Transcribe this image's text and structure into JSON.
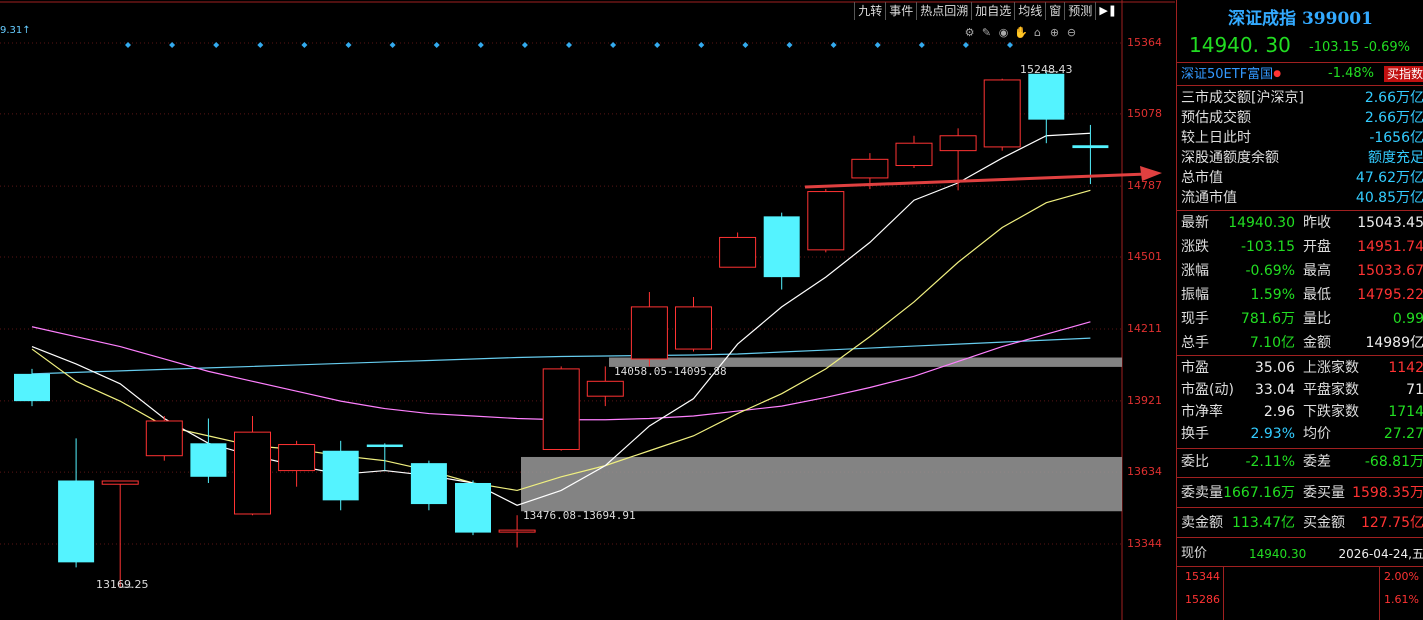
{
  "toolbar": {
    "items": [
      "九转",
      "事件",
      "热点回溯",
      "加自选",
      "均线",
      "窗",
      "预测"
    ],
    "playback_icon": "play-pause-icon"
  },
  "mini_icons": [
    "settings-icon",
    "pen-icon",
    "eye-icon",
    "hand-icon",
    "lock-icon",
    "zoom-in-icon",
    "zoom-out-icon"
  ],
  "top_left_label": "9.31↑",
  "colors": {
    "up": "#ff3333",
    "down": "#54f3ff",
    "ma5": "#ffffff",
    "ma10": "#f0f080",
    "ma20": "#ff80ff",
    "ma60": "#66ccee",
    "arrow": "#e04040",
    "zone": "#9a9a9a",
    "diamond": "#33aaee"
  },
  "chart_data": {
    "type": "candlestick",
    "y_ticks": [
      "15364",
      "15078",
      "14787",
      "14501",
      "14211",
      "13921",
      "13634",
      "13344"
    ],
    "ylim": [
      13170,
      15400
    ],
    "candles": [
      {
        "o": 14030,
        "c": 13920,
        "h": 14050,
        "l": 13900
      },
      {
        "o": 13600,
        "c": 13270,
        "h": 13770,
        "l": 13250
      },
      {
        "o": 13585,
        "c": 13598,
        "h": 13600,
        "l": 13170
      },
      {
        "o": 13700,
        "c": 13840,
        "h": 13860,
        "l": 13680
      },
      {
        "o": 13750,
        "c": 13615,
        "h": 13850,
        "l": 13590
      },
      {
        "o": 13465,
        "c": 13795,
        "h": 13860,
        "l": 13460
      },
      {
        "o": 13640,
        "c": 13745,
        "h": 13760,
        "l": 13575
      },
      {
        "o": 13720,
        "c": 13520,
        "h": 13760,
        "l": 13480
      },
      {
        "o": 13745,
        "c": 13735,
        "h": 13750,
        "l": 13640
      },
      {
        "o": 13670,
        "c": 13505,
        "h": 13680,
        "l": 13480
      },
      {
        "o": 13590,
        "c": 13390,
        "h": 13600,
        "l": 13380
      },
      {
        "o": 13400,
        "c": 13400,
        "h": 13460,
        "l": 13330
      },
      {
        "o": 13725,
        "c": 14050,
        "h": 14060,
        "l": 13720
      },
      {
        "o": 13940,
        "c": 14000,
        "h": 14060,
        "l": 13900
      },
      {
        "o": 14090,
        "c": 14300,
        "h": 14360,
        "l": 14060
      },
      {
        "o": 14130,
        "c": 14300,
        "h": 14340,
        "l": 14120
      },
      {
        "o": 14460,
        "c": 14580,
        "h": 14600,
        "l": 14460
      },
      {
        "o": 14665,
        "c": 14420,
        "h": 14680,
        "l": 14370
      },
      {
        "o": 14530,
        "c": 14765,
        "h": 14775,
        "l": 14520
      },
      {
        "o": 14820,
        "c": 14895,
        "h": 14920,
        "l": 14775
      },
      {
        "o": 14870,
        "c": 14960,
        "h": 14990,
        "l": 14860
      },
      {
        "o": 14930,
        "c": 14990,
        "h": 15020,
        "l": 14770
      },
      {
        "o": 14945,
        "c": 15215,
        "h": 15220,
        "l": 14930
      },
      {
        "o": 15240,
        "c": 15055,
        "h": 15248.43,
        "l": 14960
      },
      {
        "o": 14951.74,
        "c": 14940.3,
        "h": 15033.67,
        "l": 14795.22
      }
    ],
    "ma5": [
      14140,
      14070,
      13990,
      13850,
      13750,
      13700,
      13660,
      13625,
      13640,
      13620,
      13590,
      13500,
      13560,
      13660,
      13820,
      13930,
      14150,
      14300,
      14420,
      14560,
      14730,
      14800,
      14900,
      14990,
      15000
    ],
    "ma10": [
      14130,
      14000,
      13920,
      13820,
      13780,
      13740,
      13725,
      13700,
      13680,
      13640,
      13590,
      13560,
      13615,
      13660,
      13720,
      13780,
      13870,
      13950,
      14050,
      14180,
      14320,
      14480,
      14620,
      14720,
      14770
    ],
    "ma20": [
      14220,
      14180,
      14140,
      14090,
      14040,
      14000,
      13960,
      13920,
      13890,
      13870,
      13860,
      13850,
      13845,
      13845,
      13850,
      13860,
      13880,
      13900,
      13935,
      13975,
      14020,
      14080,
      14140,
      14190,
      14240
    ],
    "ma60": [
      14030,
      14036,
      14042,
      14048,
      14054,
      14060,
      14066,
      14072,
      14078,
      14084,
      14090,
      14096,
      14100,
      14102,
      14104,
      14106,
      14110,
      14118,
      14126,
      14134,
      14142,
      14150,
      14158,
      14166,
      14174
    ],
    "zones": [
      {
        "low": 14058.05,
        "high": 14095.88,
        "label": "14058.05-14095.88"
      },
      {
        "low": 13476.08,
        "high": 13694.91,
        "label": "13476.08-13694.91"
      }
    ],
    "annotations": {
      "high_label": "15248.43",
      "low_label": "13169.25"
    }
  },
  "panel": {
    "title": "深证成指 399001",
    "price": "14940. 30",
    "change": "-103.15",
    "pct": "-0.69%",
    "etf_name": "深证50ETF富国",
    "etf_pct": "-1.48%",
    "buy_label": "买指数",
    "info": [
      {
        "label": "三市成交额[沪深京]",
        "value": "2.66万亿"
      },
      {
        "label": "预估成交额",
        "value": "2.66万亿"
      },
      {
        "label": "较上日此时",
        "value": "-1656亿"
      },
      {
        "label": "深股通额度余额",
        "value": "额度充足"
      },
      {
        "label": "总市值",
        "value": "47.62万亿"
      },
      {
        "label": "流通市值",
        "value": "40.85万亿"
      }
    ],
    "quote": [
      {
        "l1": "最新",
        "v1": "14940.30",
        "l2": "昨收",
        "v2": "15043.45"
      },
      {
        "l1": "涨跌",
        "v1": "-103.15",
        "l2": "开盘",
        "v2": "14951.74"
      },
      {
        "l1": "涨幅",
        "v1": "-0.69%",
        "l2": "最高",
        "v2": "15033.67"
      },
      {
        "l1": "振幅",
        "v1": "1.59%",
        "l2": "最低",
        "v2": "14795.22"
      },
      {
        "l1": "现手",
        "v1": "781.6万",
        "l2": "量比",
        "v2": "0.99"
      },
      {
        "l1": "总手",
        "v1": "7.10亿",
        "l2": "金额",
        "v2": "14989亿"
      }
    ],
    "valuation": [
      {
        "l1": "市盈",
        "v1": "35.06",
        "l2": "上涨家数",
        "v2": "1142"
      },
      {
        "l1": "市盈(动)",
        "v1": "33.04",
        "l2": "平盘家数",
        "v2": "71"
      },
      {
        "l1": "市净率",
        "v1": "2.96",
        "l2": "下跌家数",
        "v2": "1714"
      },
      {
        "l1": "换手",
        "v1": "2.93%",
        "l2": "均价",
        "v2": "27.27"
      }
    ],
    "commission": {
      "l1": "委比",
      "v1": "-2.11%",
      "l2": "委差",
      "v2": "-68.81万"
    },
    "orders": {
      "l1": "委卖量",
      "v1": "1667.16万",
      "l2": "委买量",
      "v2": "1598.35万"
    },
    "amounts": {
      "l1": "卖金额",
      "v1": "113.47亿",
      "l2": "买金额",
      "v2": "127.75亿"
    },
    "bottom": {
      "label": "现价",
      "price": "14940.30",
      "date": "2026-04-24,五"
    },
    "mini": [
      {
        "price": "15344",
        "pct": "2.00%"
      },
      {
        "price": "15286",
        "pct": "1.61%"
      }
    ]
  }
}
